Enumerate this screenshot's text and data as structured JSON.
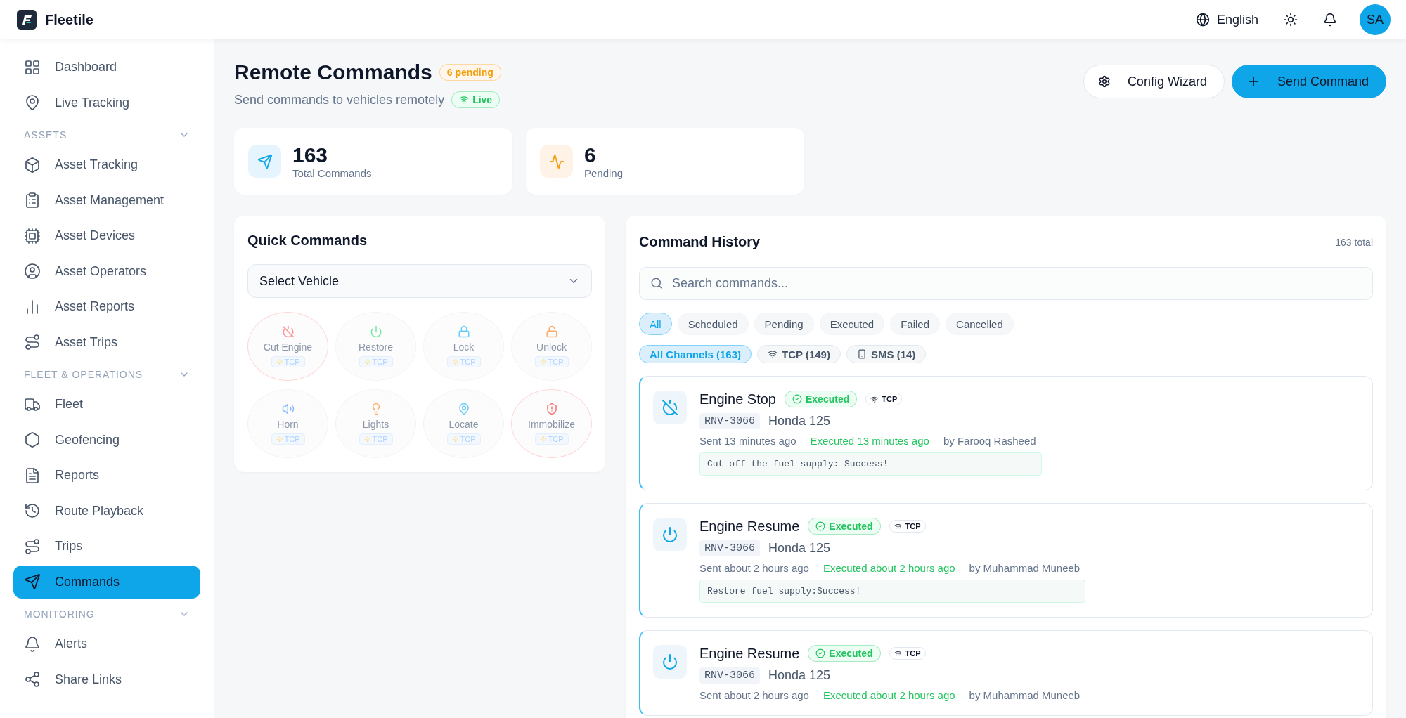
{
  "brand": {
    "name": "Fleetile"
  },
  "topbar": {
    "language": "English",
    "avatar": "SA"
  },
  "sidebar": {
    "items": [
      {
        "kind": "link",
        "label": "Dashboard",
        "selected": false
      },
      {
        "kind": "link",
        "label": "Live Tracking",
        "selected": false
      },
      {
        "kind": "section",
        "label": "ASSETS",
        "expanded": true
      },
      {
        "kind": "link",
        "label": "Asset Tracking",
        "selected": false
      },
      {
        "kind": "link",
        "label": "Asset Management",
        "selected": false
      },
      {
        "kind": "link",
        "label": "Asset Devices",
        "selected": false
      },
      {
        "kind": "link",
        "label": "Asset Operators",
        "selected": false
      },
      {
        "kind": "link",
        "label": "Asset Reports",
        "selected": false
      },
      {
        "kind": "link",
        "label": "Asset Trips",
        "selected": false
      },
      {
        "kind": "section",
        "label": "FLEET & OPERATIONS",
        "expanded": true
      },
      {
        "kind": "link",
        "label": "Fleet",
        "selected": false
      },
      {
        "kind": "link",
        "label": "Geofencing",
        "selected": false
      },
      {
        "kind": "link",
        "label": "Reports",
        "selected": false
      },
      {
        "kind": "link",
        "label": "Route Playback",
        "selected": false
      },
      {
        "kind": "link",
        "label": "Trips",
        "selected": false
      },
      {
        "kind": "link",
        "label": "Commands",
        "selected": true
      },
      {
        "kind": "section",
        "label": "MONITORING",
        "expanded": true
      },
      {
        "kind": "link",
        "label": "Alerts",
        "selected": false
      },
      {
        "kind": "link",
        "label": "Share Links",
        "selected": false
      }
    ]
  },
  "page": {
    "title": "Remote Commands",
    "pending_badge": "6 pending",
    "subtitle": "Send commands to vehicles remotely",
    "live_badge": "Live",
    "buttons": [
      {
        "kind": "secondary",
        "label": "Config Wizard"
      },
      {
        "kind": "primary",
        "label": "Send Command"
      }
    ]
  },
  "stats": [
    {
      "kind": "sent",
      "value": "163",
      "label": "Total Commands"
    },
    {
      "kind": "activity",
      "value": "6",
      "label": "Pending"
    }
  ],
  "quick_commands": {
    "title": "Quick Commands",
    "vehicle_select": {
      "placeholder": "Select Vehicle"
    },
    "disabled": true,
    "commands": [
      {
        "label": "Cut Engine",
        "channel": "TCP",
        "danger": true
      },
      {
        "label": "Restore",
        "channel": "TCP",
        "danger": false
      },
      {
        "label": "Lock",
        "channel": "TCP",
        "danger": false
      },
      {
        "label": "Unlock",
        "channel": "TCP",
        "danger": false
      },
      {
        "label": "Horn",
        "channel": "TCP",
        "danger": false
      },
      {
        "label": "Lights",
        "channel": "TCP",
        "danger": false
      },
      {
        "label": "Locate",
        "channel": "TCP",
        "danger": false
      },
      {
        "label": "Immobilize",
        "channel": "TCP",
        "danger": true
      }
    ]
  },
  "history": {
    "title": "Command History",
    "total": "163 total",
    "search": {
      "placeholder": "Search commands..."
    },
    "status_filters": [
      {
        "label": "All",
        "selected": true
      },
      {
        "label": "Scheduled",
        "selected": false
      },
      {
        "label": "Pending",
        "selected": false
      },
      {
        "label": "Executed",
        "selected": false
      },
      {
        "label": "Failed",
        "selected": false
      },
      {
        "label": "Cancelled",
        "selected": false
      }
    ],
    "channel_filters": [
      {
        "kind": "all",
        "label": "All Channels (163)",
        "selected": true
      },
      {
        "kind": "tcp",
        "label": "TCP (149)",
        "selected": false
      },
      {
        "kind": "sms",
        "label": "SMS (14)",
        "selected": false
      }
    ],
    "entries": [
      {
        "kind": "stop",
        "title": "Engine Stop",
        "status": "Executed",
        "channel": "TCP",
        "plate": "RNV-3066",
        "vehicle": "Honda 125",
        "sent": "Sent 13 minutes ago",
        "executed": "Executed 13 minutes ago",
        "by": "by Farooq Rasheed",
        "response": "Cut off the fuel supply: Success!"
      },
      {
        "kind": "resume",
        "title": "Engine Resume",
        "status": "Executed",
        "channel": "TCP",
        "plate": "RNV-3066",
        "vehicle": "Honda 125",
        "sent": "Sent about 2 hours ago",
        "executed": "Executed about 2 hours ago",
        "by": "by Muhammad Muneeb",
        "response": "Restore fuel supply:Success!"
      },
      {
        "kind": "resume",
        "title": "Engine Resume",
        "status": "Executed",
        "channel": "TCP",
        "plate": "RNV-3066",
        "vehicle": "Honda 125",
        "sent": "Sent about 2 hours ago",
        "executed": "Executed about 2 hours ago",
        "by": "by Muhammad Muneeb"
      }
    ]
  }
}
